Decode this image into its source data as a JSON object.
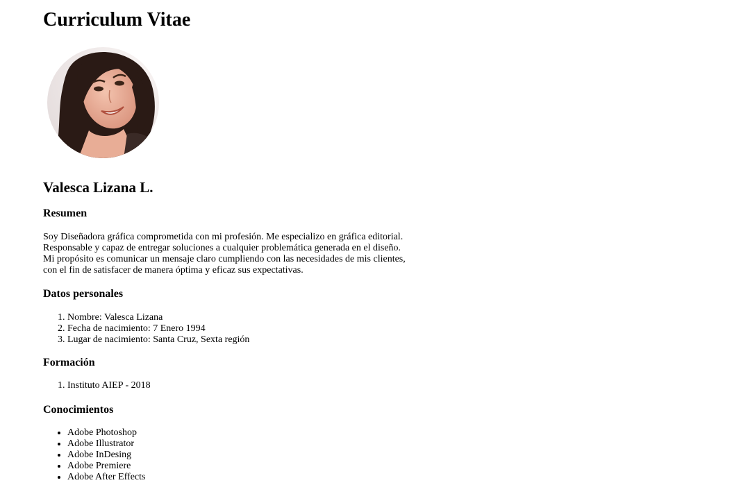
{
  "title": "Curriculum Vitae",
  "name": "Valesca Lizana L.",
  "summary": {
    "heading": "Resumen",
    "lines": [
      "Soy Diseñadora gráfica comprometida con mi profesión. Me especializo en gráfica editorial.",
      "Responsable y capaz de entregar soluciones a cualquier problemática generada en el diseño.",
      "Mi propósito es comunicar un mensaje claro cumpliendo con las necesidades de mis clientes,",
      "con el fin de satisfacer de manera óptima y eficaz sus expectativas."
    ]
  },
  "personal": {
    "heading": "Datos personales",
    "items": [
      "Nombre: Valesca Lizana",
      "Fecha de nacimiento: 7 Enero 1994",
      "Lugar de nacimiento: Santa Cruz, Sexta región"
    ]
  },
  "education": {
    "heading": "Formación",
    "items": [
      "Instituto AIEP - 2018"
    ]
  },
  "skills": {
    "heading": "Conocimientos",
    "items": [
      "Adobe Photoshop",
      "Adobe Illustrator",
      "Adobe InDesing",
      "Adobe Premiere",
      "Adobe After Effects"
    ]
  }
}
